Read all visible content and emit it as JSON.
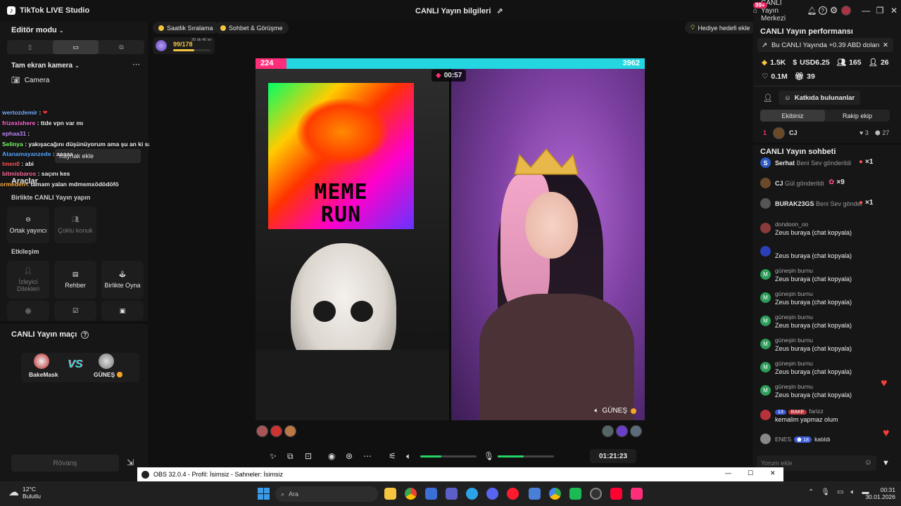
{
  "titlebar": {
    "app_name": "TikTok LIVE Studio",
    "center_title": "CANLI Yayın bilgileri",
    "center_link": "CANLI Yayın Merkezi",
    "notif_badge": "99+"
  },
  "left": {
    "editor_mode": "Editör modu",
    "camera_section": "Tam ekran kamera",
    "camera_item": "Camera",
    "add_source": "Kaynak ekle",
    "tools": "Araçlar",
    "together": "Birlikte CANLI Yayın yapın",
    "tiles_row1": [
      "Ortak yayıncı",
      "Çoklu konuk"
    ],
    "interaction": "Etkileşim",
    "tiles_row2": [
      "İzleyici Dilekleri",
      "Rehber",
      "Birlikte Oyna"
    ],
    "match_title": "CANLI Yayın maçı",
    "vs": "VS",
    "player1": "BakeMask",
    "player2": "GÜNEŞ",
    "rematch": "Rövanş"
  },
  "overlay_chat": [
    {
      "user": "wertozdemir",
      "msg": ":"
    },
    {
      "user": "frizexishere",
      "msg": ": ttde vpn var mı"
    },
    {
      "user": "ephaa31",
      "msg": ":"
    },
    {
      "user": "Selinya",
      "msg": ": yakışacağını düşünüyorum ama şu an ki saç rengimi de seviyorum bakacaz"
    },
    {
      "user": "Atanamayanzede",
      "msg": ": aaaaa"
    },
    {
      "user": "tmen0",
      "msg": ": abi"
    },
    {
      "user": "bitmisbaros",
      "msg": ": saçını kes"
    },
    {
      "user": "ormeden",
      "msg": ": tamam yalan mdmsmxödödöfö"
    }
  ],
  "top_pills": {
    "hourly": "Saatlik Sıralama",
    "chat_meet": "Sohbet & Görüşme",
    "gift_goal": "Hediye hedefi ekle",
    "progress": "99/178",
    "countdown": "30 dk 40 sn",
    "progress_fraction": 0.56
  },
  "stage": {
    "score_left": "224",
    "score_right": "3962",
    "timer": "00:57",
    "meme_line1": "MEME",
    "meme_line2": "RUN",
    "right_name": "GÜNEŞ"
  },
  "controls": {
    "stream_time": "01:21:23",
    "volume_fraction": 0.38,
    "mic_fraction": 0.46
  },
  "right": {
    "perf_title": "CANLI Yayın performansı",
    "banner": "Bu CANLI Yayında +0.39 ABD doları",
    "stats": [
      "1.5K",
      "USD6.25",
      "165",
      "26",
      "0.1M",
      "39"
    ],
    "contributors": "Katkıda bulunanlar",
    "team_tabs": [
      "Ekibiniz",
      "Rakip ekip"
    ],
    "rank_no": "1",
    "rank_name": "CJ",
    "rank_stat1": "3",
    "rank_stat2": "27",
    "chat_title": "CANLI Yayın sohbeti",
    "gifts": [
      {
        "user": "Serhat",
        "text": "Beni Sev gönderildi",
        "count": "×1"
      },
      {
        "user": "CJ",
        "text": "Gül gönderildi",
        "count": "×9"
      },
      {
        "user": "BURAK23GS",
        "text": "Beni Sev gönder",
        "count": "×1"
      }
    ],
    "messages": [
      {
        "user": "dondoon_oo",
        "msg": "Zeus buraya (chat kopyala)"
      },
      {
        "user": "",
        "msg": "Zeus buraya (chat kopyala)"
      },
      {
        "user": "güneşin burnu",
        "msg": "Zeus buraya (chat kopyala)"
      },
      {
        "user": "güneşin burnu",
        "msg": "Zeus buraya (chat kopyala)"
      },
      {
        "user": "güneşin burnu",
        "msg": "Zeus buraya (chat kopyala)"
      },
      {
        "user": "güneşin burnu",
        "msg": "Zeus buraya (chat kopyala)"
      },
      {
        "user": "güneşin burnu",
        "msg": "Zeus buraya (chat kopyala)"
      },
      {
        "user": "güneşin burnu",
        "msg": "Zeus buraya (chat kopyala)"
      },
      {
        "user": "farizz",
        "msg": "kemalim yapmaz olum"
      }
    ],
    "badge_level1": "13",
    "badge_text": "BAKE",
    "join_user": "ENES",
    "join_level": "18",
    "join_text": "katıldı",
    "comment_placeholder": "Yorum ekle"
  },
  "obs": {
    "title": "OBS 32.0.4 - Profil: İsimsiz - Sahneler: İsimsiz"
  },
  "taskbar": {
    "weather_temp": "12°C",
    "weather_desc": "Bulutlu",
    "search_placeholder": "Ara",
    "time": "00:31",
    "date": "30.01.2026"
  },
  "colors": {
    "accent_green": "#25d366",
    "tiktok_pink": "#ff2e7a",
    "tiktok_cyan": "#24d6e0"
  }
}
